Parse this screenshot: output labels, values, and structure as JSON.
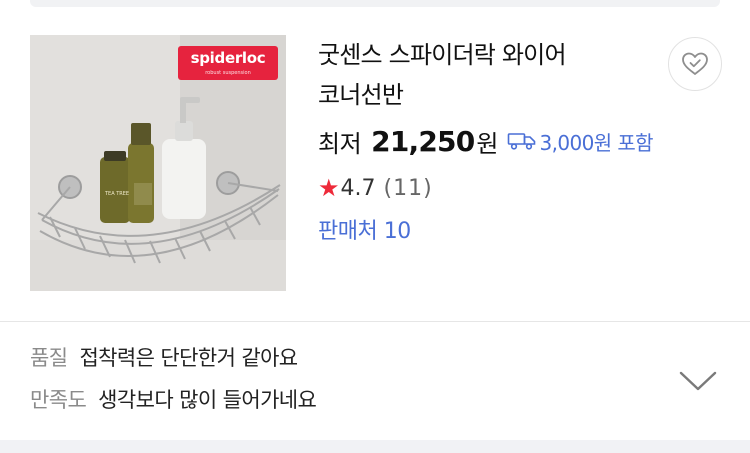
{
  "product": {
    "title_line1": "굿센스 스파이더락 와이어",
    "title_line2": "코너선반",
    "price_label": "최저",
    "price_value": "21,250",
    "price_unit": "원",
    "shipping_text": "3,000원 포함",
    "rating": "4.7",
    "review_count": "(11)",
    "sellers": "판매처 10",
    "brand_logo_text": "spiderloc",
    "brand_logo_sub": "robust suspension",
    "bottle_label": "TEA TREE"
  },
  "review_summary": {
    "lines": [
      {
        "key": "품질",
        "text": "접착력은 단단한거 같아요"
      },
      {
        "key": "만족도",
        "text": "생각보다 많이 들어가네요"
      }
    ]
  },
  "icons": {
    "wish": "heart-check-icon",
    "shipping": "truck-icon",
    "star": "star-icon",
    "expand": "chevron-down-icon"
  },
  "colors": {
    "link_blue": "#4a6fd6",
    "star_red": "#ee2a3a",
    "brand_red": "#e6233e",
    "muted_gray": "#8a8a8a"
  }
}
